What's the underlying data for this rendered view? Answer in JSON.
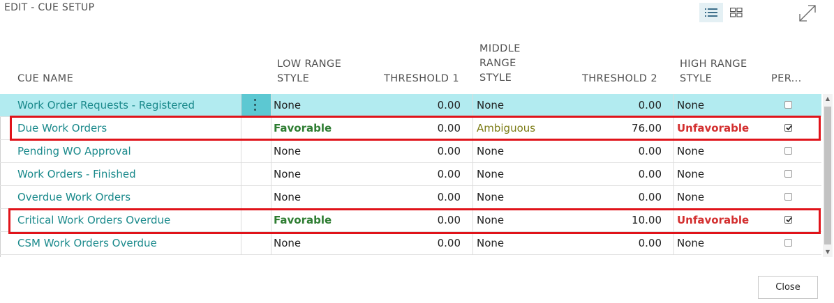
{
  "page": {
    "title": "EDIT - CUE SETUP"
  },
  "toolbar": {
    "list_view_icon": "list-view-icon",
    "tile_view_icon": "tile-view-icon",
    "expand_icon": "expand-icon"
  },
  "columns": {
    "cue_name": "CUE NAME",
    "low_range_style": "LOW RANGE\nSTYLE",
    "threshold1": "THRESHOLD 1",
    "middle_range_style": "MIDDLE\nRANGE\nSTYLE",
    "threshold2": "THRESHOLD 2",
    "high_range_style": "HIGH RANGE\nSTYLE",
    "per": "PER..."
  },
  "rows": [
    {
      "name": "Work Order Requests - Registered",
      "low": "None",
      "t1": "0.00",
      "mid": "None",
      "t2": "0.00",
      "high": "None",
      "per": false,
      "selected": true
    },
    {
      "name": "Due Work Orders",
      "low": "Favorable",
      "t1": "0.00",
      "mid": "Ambiguous",
      "t2": "76.00",
      "high": "Unfavorable",
      "per": true,
      "selected": false
    },
    {
      "name": "Pending WO Approval",
      "low": "None",
      "t1": "0.00",
      "mid": "None",
      "t2": "0.00",
      "high": "None",
      "per": false,
      "selected": false
    },
    {
      "name": "Work Orders - Finished",
      "low": "None",
      "t1": "0.00",
      "mid": "None",
      "t2": "0.00",
      "high": "None",
      "per": false,
      "selected": false
    },
    {
      "name": "Overdue Work Orders",
      "low": "None",
      "t1": "0.00",
      "mid": "None",
      "t2": "0.00",
      "high": "None",
      "per": false,
      "selected": false
    },
    {
      "name": "Critical Work Orders Overdue",
      "low": "Favorable",
      "t1": "0.00",
      "mid": "None",
      "t2": "10.00",
      "high": "Unfavorable",
      "per": true,
      "selected": false
    },
    {
      "name": "CSM Work Orders Overdue",
      "low": "None",
      "t1": "0.00",
      "mid": "None",
      "t2": "0.00",
      "high": "None",
      "per": false,
      "selected": false
    }
  ],
  "footer": {
    "close_label": "Close"
  },
  "colors": {
    "accent_link": "#1b8a8c",
    "selected_row": "#b2ebf0",
    "favorable": "#2e7d32",
    "unfavorable": "#d32f2f",
    "ambiguous": "#7b7b14",
    "highlight_box": "#e0131a"
  }
}
